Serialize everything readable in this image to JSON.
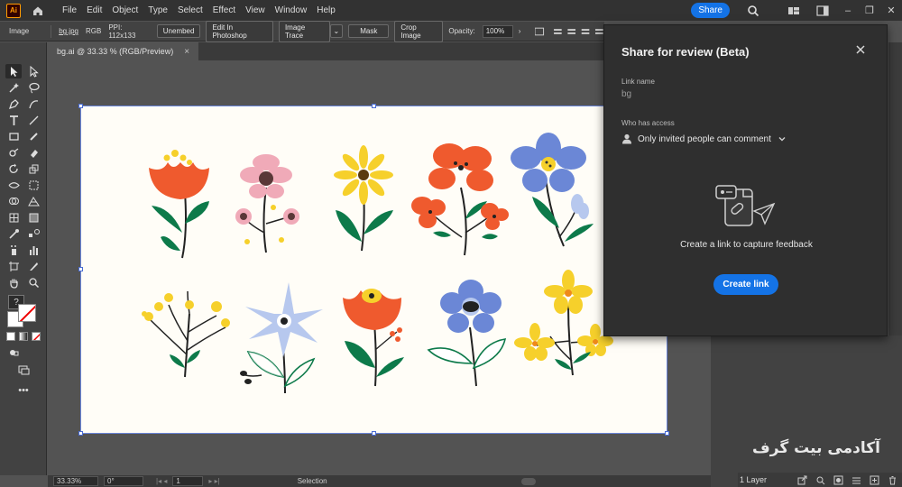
{
  "app": {
    "logo": "Ai"
  },
  "menu": [
    "File",
    "Edit",
    "Object",
    "Type",
    "Select",
    "Effect",
    "View",
    "Window",
    "Help"
  ],
  "topbar": {
    "share_label": "Share"
  },
  "controlbar": {
    "selection_type": "Image",
    "file_name": "bg.jpg",
    "color_mode": "RGB",
    "ppi": "PPI: 112x133",
    "unembed_label": "Unembed",
    "edit_photoshop_label": "Edit In Photoshop",
    "image_trace_label": "Image Trace",
    "mask_label": "Mask",
    "crop_label": "Crop Image",
    "opacity_label": "Opacity:",
    "opacity_value": "100%"
  },
  "document_tab": {
    "title": "bg.ai @ 33.33 % (RGB/Preview)",
    "close": "×"
  },
  "statusbar": {
    "zoom": "33.33%",
    "rotation": "0°",
    "artboard": "1",
    "mode": "Selection"
  },
  "layers": {
    "count_label": "1 Layer"
  },
  "watermark": "آکادمی بیت گرف",
  "share_panel": {
    "title": "Share for review (Beta)",
    "link_name_label": "Link name",
    "link_name_value": "bg",
    "access_label": "Who has access",
    "access_value": "Only invited people can comment",
    "caption": "Create a link to capture feedback",
    "create_button": "Create link"
  },
  "colors": {
    "accent": "#1473e6",
    "flower_orange": "#ef5a2e",
    "flower_yellow": "#f6d02b",
    "flower_pink": "#f0aab8",
    "flower_blue": "#6b87d6",
    "flower_lightblue": "#b7c8ee",
    "leaf_green": "#0d7a4a"
  },
  "icons": [
    "home-icon",
    "search-icon",
    "arrange-icon",
    "panel-icon",
    "close-icon",
    "user-icon",
    "chevron-down-icon",
    "feedback-illustration-icon"
  ]
}
